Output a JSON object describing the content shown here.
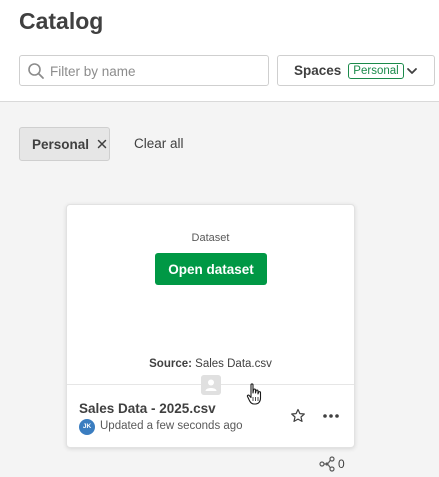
{
  "header": {
    "title": "Catalog",
    "search": {
      "placeholder": "Filter by name",
      "value": ""
    },
    "spaces": {
      "label": "Spaces",
      "badge": "Personal"
    }
  },
  "filters": {
    "chips": [
      {
        "label": "Personal"
      }
    ],
    "clear_all_label": "Clear all"
  },
  "card": {
    "type_label": "Dataset",
    "open_button_label": "Open dataset",
    "source_key": "Source:",
    "source_value": "Sales Data.csv",
    "title": "Sales Data - 2025.csv",
    "avatar_initials": "JK",
    "updated_text": "Updated a few seconds ago"
  },
  "lineage": {
    "count": "0"
  },
  "colors": {
    "accent_green": "#009845",
    "badge_green": "#1a8a4a",
    "avatar_blue": "#3a7dc0",
    "background": "#f4f4f4"
  },
  "icons": {
    "search": "search-icon",
    "chevron": "chevron-down-icon",
    "chip_close": "close-icon",
    "owner": "user-icon",
    "favorite": "star-icon",
    "more": "more-horizontal-icon",
    "lineage": "lineage-icon",
    "cursor": "hand-pointer-cursor"
  }
}
